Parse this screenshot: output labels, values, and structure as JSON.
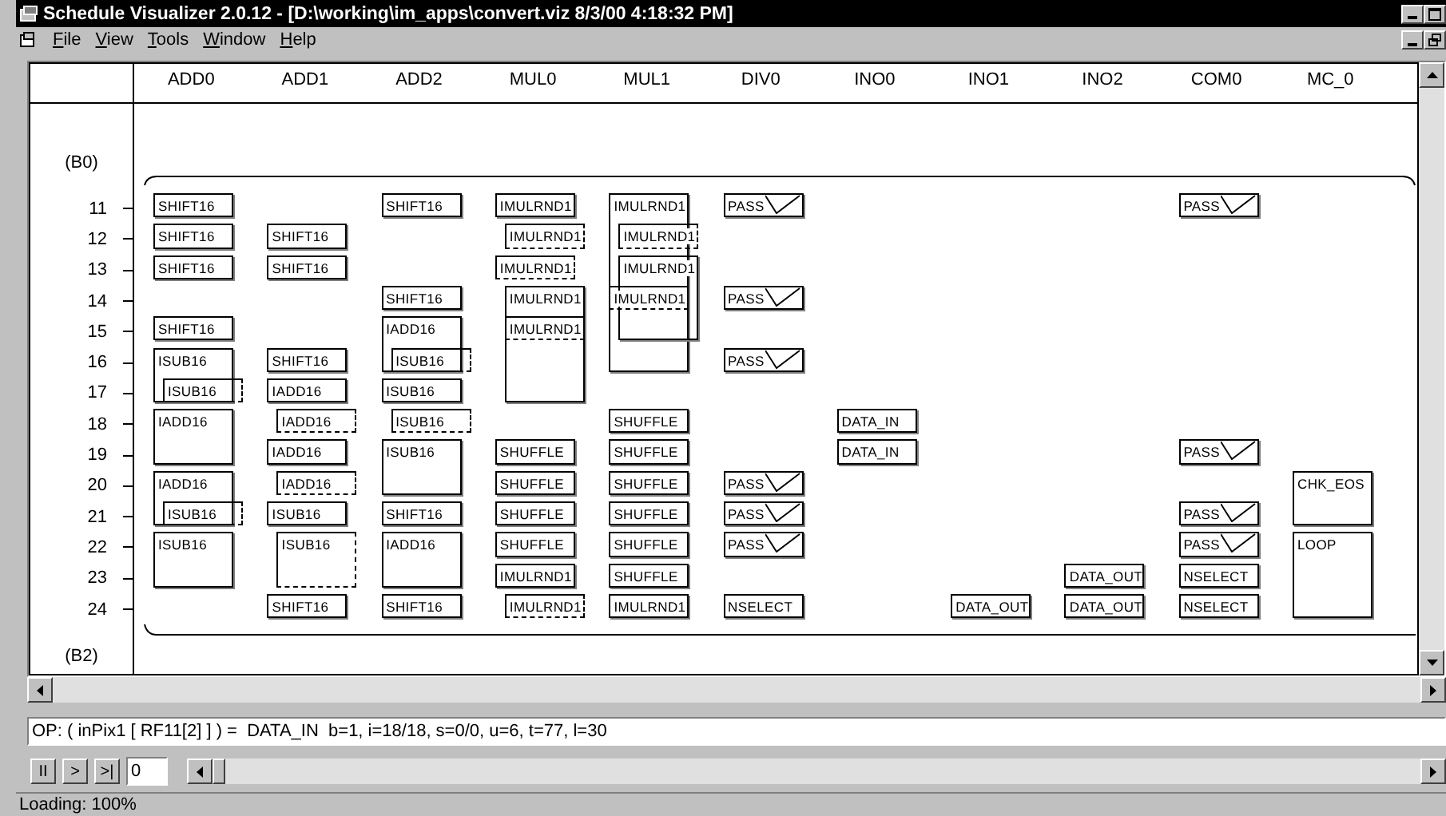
{
  "window": {
    "title": "Schedule Visualizer 2.0.12 - [D:\\working\\im_apps\\convert.viz 8/3/00 4:18:32 PM]"
  },
  "menu": [
    "File",
    "View",
    "Tools",
    "Window",
    "Help"
  ],
  "columns": [
    "ADD0",
    "ADD1",
    "ADD2",
    "MUL0",
    "MUL1",
    "DIV0",
    "INO0",
    "INO1",
    "INO2",
    "COM0",
    "MC_0"
  ],
  "top_label": "(B0)",
  "bottom_label": "(B2)",
  "rows": [
    "11",
    "12",
    "13",
    "14",
    "15",
    "16",
    "17",
    "18",
    "19",
    "20",
    "21",
    "22",
    "23",
    "24"
  ],
  "blocks": [
    {
      "label": "SHIFT16",
      "kind": "op",
      "dashed": false
    },
    {
      "label": "SHIFT16",
      "kind": "op",
      "dashed": false
    },
    {
      "label": "SHIFT16",
      "kind": "op",
      "dashed": false
    },
    {
      "label": "SHIFT16",
      "kind": "op",
      "dashed": false
    },
    {
      "label": "ISUB16",
      "kind": "op",
      "dashed": false
    },
    {
      "label": "ISUB16",
      "kind": "op",
      "dashed": true
    },
    {
      "label": "IADD16",
      "kind": "op",
      "dashed": false
    },
    {
      "label": "IADD16",
      "kind": "op",
      "dashed": false
    },
    {
      "label": "ISUB16",
      "kind": "op",
      "dashed": true
    },
    {
      "label": "ISUB16",
      "kind": "op",
      "dashed": false
    },
    {
      "label": "SHIFT16",
      "kind": "op",
      "dashed": false
    },
    {
      "label": "SHIFT16",
      "kind": "op",
      "dashed": false
    },
    {
      "label": "SHIFT16",
      "kind": "op",
      "dashed": false
    },
    {
      "label": "IADD16",
      "kind": "op",
      "dashed": false
    },
    {
      "label": "IADD16",
      "kind": "op",
      "dashed": true
    },
    {
      "label": "IADD16",
      "kind": "op",
      "dashed": false
    },
    {
      "label": "IADD16",
      "kind": "op",
      "dashed": true
    },
    {
      "label": "ISUB16",
      "kind": "op",
      "dashed": false
    },
    {
      "label": "ISUB16",
      "kind": "op",
      "dashed": true
    },
    {
      "label": "SHIFT16",
      "kind": "op",
      "dashed": false
    },
    {
      "label": "SHIFT16",
      "kind": "op",
      "dashed": false
    },
    {
      "label": "SHIFT16",
      "kind": "op",
      "dashed": false
    },
    {
      "label": "IADD16",
      "kind": "op",
      "dashed": false
    },
    {
      "label": "ISUB16",
      "kind": "op",
      "dashed": true
    },
    {
      "label": "ISUB16",
      "kind": "op",
      "dashed": false
    },
    {
      "label": "ISUB16",
      "kind": "op",
      "dashed": true
    },
    {
      "label": "ISUB16",
      "kind": "op",
      "dashed": false
    },
    {
      "label": "SHIFT16",
      "kind": "op",
      "dashed": false
    },
    {
      "label": "IADD16",
      "kind": "op",
      "dashed": false
    },
    {
      "label": "SHIFT16",
      "kind": "op",
      "dashed": false
    },
    {
      "label": "IMULRND1",
      "kind": "op",
      "dashed": false
    },
    {
      "label": "IMULRND1",
      "kind": "op",
      "dashed": true
    },
    {
      "label": "IMULRND1",
      "kind": "op",
      "dashed": true
    },
    {
      "label": "IMULRND1",
      "kind": "op",
      "dashed": false
    },
    {
      "label": "IMULRND1",
      "kind": "op",
      "dashed": true
    },
    {
      "label": "SHUFFLE",
      "kind": "op",
      "dashed": false
    },
    {
      "label": "SHUFFLE",
      "kind": "op",
      "dashed": false
    },
    {
      "label": "SHUFFLE",
      "kind": "op",
      "dashed": false
    },
    {
      "label": "SHUFFLE",
      "kind": "op",
      "dashed": false
    },
    {
      "label": "IMULRND1",
      "kind": "op",
      "dashed": false
    },
    {
      "label": "IMULRND1",
      "kind": "op",
      "dashed": true
    },
    {
      "label": "IMULRND1",
      "kind": "op",
      "dashed": false
    },
    {
      "label": "IMULRND1",
      "kind": "op",
      "dashed": true
    },
    {
      "label": "IMULRND1",
      "kind": "op",
      "dashed": false
    },
    {
      "label": "IMULRND1",
      "kind": "op",
      "dashed": true
    },
    {
      "label": "SHUFFLE",
      "kind": "op",
      "dashed": false
    },
    {
      "label": "SHUFFLE",
      "kind": "op",
      "dashed": false
    },
    {
      "label": "SHUFFLE",
      "kind": "op",
      "dashed": false
    },
    {
      "label": "SHUFFLE",
      "kind": "op",
      "dashed": false
    },
    {
      "label": "SHUFFLE",
      "kind": "op",
      "dashed": false
    },
    {
      "label": "SHUFFLE",
      "kind": "op",
      "dashed": false
    },
    {
      "label": "IMULRND1",
      "kind": "op",
      "dashed": false
    },
    {
      "label": "PASS",
      "kind": "pass",
      "dashed": false
    },
    {
      "label": "PASS",
      "kind": "pass",
      "dashed": false
    },
    {
      "label": "PASS",
      "kind": "pass",
      "dashed": false
    },
    {
      "label": "PASS",
      "kind": "pass",
      "dashed": false
    },
    {
      "label": "PASS",
      "kind": "pass",
      "dashed": false
    },
    {
      "label": "PASS",
      "kind": "pass",
      "dashed": false
    },
    {
      "label": "NSELECT",
      "kind": "op",
      "dashed": false
    },
    {
      "label": "DATA_IN",
      "kind": "op",
      "dashed": false
    },
    {
      "label": "DATA_IN",
      "kind": "op",
      "dashed": false
    },
    {
      "label": "DATA_OUT",
      "kind": "op",
      "dashed": false
    },
    {
      "label": "DATA_OUT",
      "kind": "op",
      "dashed": false
    },
    {
      "label": "DATA_OUT",
      "kind": "op",
      "dashed": false
    },
    {
      "label": "PASS",
      "kind": "pass",
      "dashed": false
    },
    {
      "label": "PASS",
      "kind": "pass",
      "dashed": false
    },
    {
      "label": "PASS",
      "kind": "pass",
      "dashed": false
    },
    {
      "label": "PASS",
      "kind": "pass",
      "dashed": false
    },
    {
      "label": "NSELECT",
      "kind": "op",
      "dashed": false
    },
    {
      "label": "NSELECT",
      "kind": "op",
      "dashed": false
    },
    {
      "label": "CHK_EOS",
      "kind": "op",
      "dashed": false
    },
    {
      "label": "LOOP",
      "kind": "op",
      "dashed": false
    }
  ],
  "op_field": {
    "value": "OP: ( inPix1 [ RF11[2] ] ) =  DATA_IN  b=1, i=18/18, s=0/0, u=6, t=77, l=30"
  },
  "controls": {
    "pause": "II",
    "play": ">",
    "step": ">|",
    "frame": "0",
    "slider": {
      "level": 0
    }
  },
  "status_bar": "Loading: 100%"
}
